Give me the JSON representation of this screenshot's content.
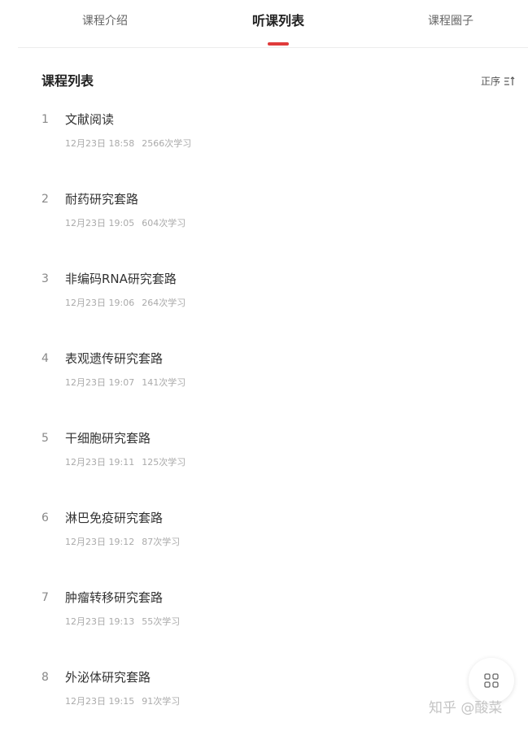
{
  "tabs": [
    {
      "label": "课程介绍"
    },
    {
      "label": "听课列表"
    },
    {
      "label": "课程圈子"
    }
  ],
  "active_tab_index": 1,
  "accent_color": "#e03a3a",
  "list": {
    "title": "课程列表",
    "sort_label": "正序",
    "sort_icon": "sort-icon"
  },
  "lessons": [
    {
      "num": "1",
      "title": "文献阅读",
      "time": "12月23日 18:58",
      "count": "2566次学习"
    },
    {
      "num": "2",
      "title": "耐药研究套路",
      "time": "12月23日 19:05",
      "count": "604次学习"
    },
    {
      "num": "3",
      "title": "非编码RNA研究套路",
      "time": "12月23日 19:06",
      "count": "264次学习"
    },
    {
      "num": "4",
      "title": "表观遗传研究套路",
      "time": "12月23日 19:07",
      "count": "141次学习"
    },
    {
      "num": "5",
      "title": "干细胞研究套路",
      "time": "12月23日 19:11",
      "count": "125次学习"
    },
    {
      "num": "6",
      "title": "淋巴免疫研究套路",
      "time": "12月23日 19:12",
      "count": "87次学习"
    },
    {
      "num": "7",
      "title": "肿瘤转移研究套路",
      "time": "12月23日 19:13",
      "count": "55次学习"
    },
    {
      "num": "8",
      "title": "外泌体研究套路",
      "time": "12月23日 19:15",
      "count": "91次学习"
    }
  ],
  "fab_icon": "grid-icon",
  "watermark": "知乎 @酸菜"
}
